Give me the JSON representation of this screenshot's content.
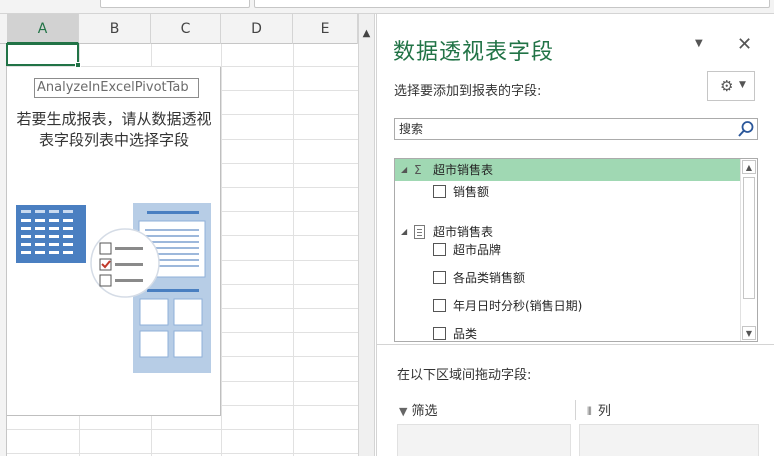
{
  "sheet": {
    "columns": [
      "A",
      "B",
      "C",
      "D",
      "E"
    ],
    "selected_column": "A"
  },
  "pivot_placeholder": {
    "name": "AnalyzeInExcelPivotTab",
    "hint": "若要生成报表，请从数据透视表字段列表中选择字段"
  },
  "field_pane": {
    "title": "数据透视表字段",
    "choose_fields_label": "选择要添加到报表的字段:",
    "search_placeholder": "搜索",
    "groups": [
      {
        "name": "超市销售表",
        "type": "measure",
        "icon": "sigma-icon",
        "highlighted": true,
        "fields": [
          {
            "label": "销售额",
            "checked": false
          }
        ]
      },
      {
        "name": "超市销售表",
        "type": "table",
        "icon": "table-icon",
        "highlighted": false,
        "fields": [
          {
            "label": "超市品牌",
            "checked": false
          },
          {
            "label": "各品类销售额",
            "checked": false
          },
          {
            "label": "年月日时分秒(销售日期)",
            "checked": false
          },
          {
            "label": "品类",
            "checked": false
          }
        ]
      }
    ],
    "drag_label": "在以下区域间拖动字段:",
    "areas": {
      "filter_label": "筛选",
      "columns_label": "列"
    }
  },
  "colors": {
    "accent": "#217346",
    "highlight": "#a0d8b3"
  }
}
